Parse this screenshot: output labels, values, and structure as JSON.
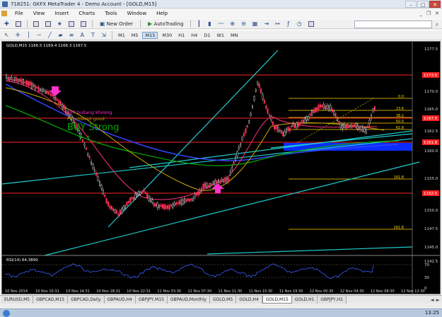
{
  "window": {
    "title": "718251: GKFX MetaTrader 4 - Demo Account - [GOLD,M15]",
    "min": "–",
    "max": "□",
    "close": "✕"
  },
  "menu": [
    "File",
    "View",
    "Insert",
    "Charts",
    "Tools",
    "Window",
    "Help"
  ],
  "toolbar": {
    "new_order": "New Order",
    "autotrading": "AutoTrading",
    "timeframes": [
      "M1",
      "M5",
      "M15",
      "M30",
      "H1",
      "H4",
      "D1",
      "W1",
      "MN"
    ],
    "active_timeframe": "M15"
  },
  "chart": {
    "symbol_header": "GOLD,M15  1166.5 1169.4 1166.3 1167.5",
    "indicator_header": "RSI(14) 64.3890",
    "annotations": {
      "text1": "TPP bullang khosng",
      "text2": "Pohottersil good",
      "buy_strong": "BUY Strong"
    },
    "price_labels": [
      "1177.5",
      "1175.0",
      "1170.0",
      "1165.0",
      "1162.5",
      "1160.0",
      "1155.0",
      "1152.5",
      "1150.0",
      "1147.5",
      "1145.0",
      "1142.5"
    ],
    "red_labels": [
      "1173.5",
      "1167.5",
      "1161.8",
      "1152.5"
    ],
    "fib_labels": [
      "0.0",
      "23.6",
      "38.2",
      "50.0",
      "61.8",
      "161.8",
      "261.8"
    ],
    "time_labels": [
      "10 Nov 2014",
      "10 Nov 10:31",
      "10 Nov 14:31",
      "10 Nov 18:31",
      "10 Nov 22:31",
      "11 Nov 03:30",
      "11 Nov 07:30",
      "11 Nov 11:30",
      "11 Nov 15:30",
      "11 Nov 19:30",
      "12 Nov 00:30",
      "12 Nov 04:30",
      "12 Nov 08:30",
      "12 Nov 12:30"
    ],
    "rsi_labels": [
      "70",
      "30",
      "0"
    ],
    "colors": {
      "background": "#000000",
      "candle_up": "#ffffff",
      "candle_down": "#ff3355",
      "resistance": "#ff2020",
      "trendline": "#22cccc",
      "fib": "#ffd700",
      "support_box": "#0a2cff",
      "buy_text": "#00aa00",
      "arrow": "#ff33cc"
    }
  },
  "tabs": [
    "EURUSD,M5",
    "GBPCAD,M15",
    "GBPCAD,Daily",
    "GBPAUD,H4",
    "GBPJPY,M15",
    "GBPAUD,Monthly",
    "GOLD,M5",
    "GOLD,H4",
    "GOLD,M15",
    "GOLD,H1",
    "GBPJPY,H1"
  ],
  "active_tab": "GOLD,M15",
  "taskbar": {
    "clock": "13:25"
  }
}
